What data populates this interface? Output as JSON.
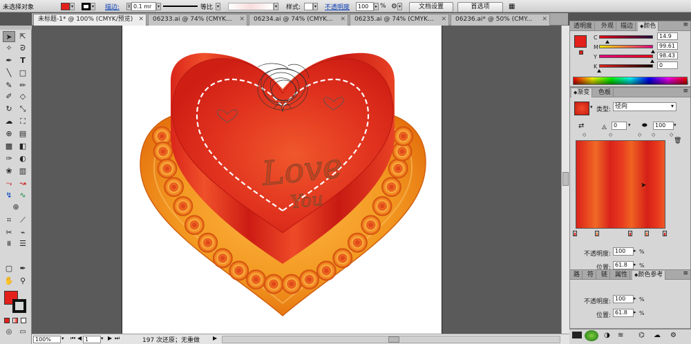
{
  "control_bar": {
    "selection_status": "未选择对象",
    "fill_color": "#e3201b",
    "stroke_color": "#000000",
    "stroke_link": "描边:",
    "stroke_weight": "0.1 mr",
    "profile_label": "等比",
    "style_label": "样式:",
    "opacity_link": "不透明度",
    "opacity_value": "100",
    "opacity_unit": "%",
    "doc_setup_button": "文档设置",
    "preferences_button": "首选项"
  },
  "tabs": [
    {
      "label": "未标题-1* @ 100% (CMYK/预览)",
      "active": true
    },
    {
      "label": "06233.ai @ 74% (CMYK...",
      "active": false
    },
    {
      "label": "06234.ai @ 74% (CMYK...",
      "active": false
    },
    {
      "label": "06235.ai @ 74% (CMYK...",
      "active": false
    },
    {
      "label": "06236.ai* @ 50% (CMY...",
      "active": false
    }
  ],
  "artwork": {
    "text_love": "Love",
    "text_you": "You",
    "colors": {
      "heart_red": "#d7231a",
      "plate_orange": "#f08a1a",
      "stitch": "#ffffff"
    }
  },
  "status_bar": {
    "zoom": "100%",
    "page": "1",
    "undo_status": "197 次还原；无重做"
  },
  "color_panel": {
    "tabs": [
      "透明度",
      "外观",
      "描边",
      "颜色"
    ],
    "active_tab": "颜色",
    "fill_color": "#e3201b",
    "channels": [
      {
        "name": "C",
        "value": "14.9",
        "fraction": 0.149
      },
      {
        "name": "M",
        "value": "99.61",
        "fraction": 0.996
      },
      {
        "name": "Y",
        "value": "98.43",
        "fraction": 0.984
      },
      {
        "name": "K",
        "value": "0",
        "fraction": 0.0
      }
    ]
  },
  "gradient_panel": {
    "tabs": [
      "渐变",
      "色板"
    ],
    "active_tab": "渐变",
    "type_label": "类型:",
    "type_value": "径向",
    "angle_value": "0",
    "aspect_value": "100",
    "opacity_label": "不透明度:",
    "opacity_value": "100",
    "location_label": "位置:",
    "location_value": "61.8",
    "percent": "%"
  },
  "guide_panel": {
    "tabs": [
      "路",
      "符",
      "链",
      "属性",
      "颜色参考"
    ],
    "opacity_label": "不透明度:",
    "opacity_value": "100",
    "location_label": "位置:",
    "location_value": "61.8",
    "percent": "%"
  }
}
